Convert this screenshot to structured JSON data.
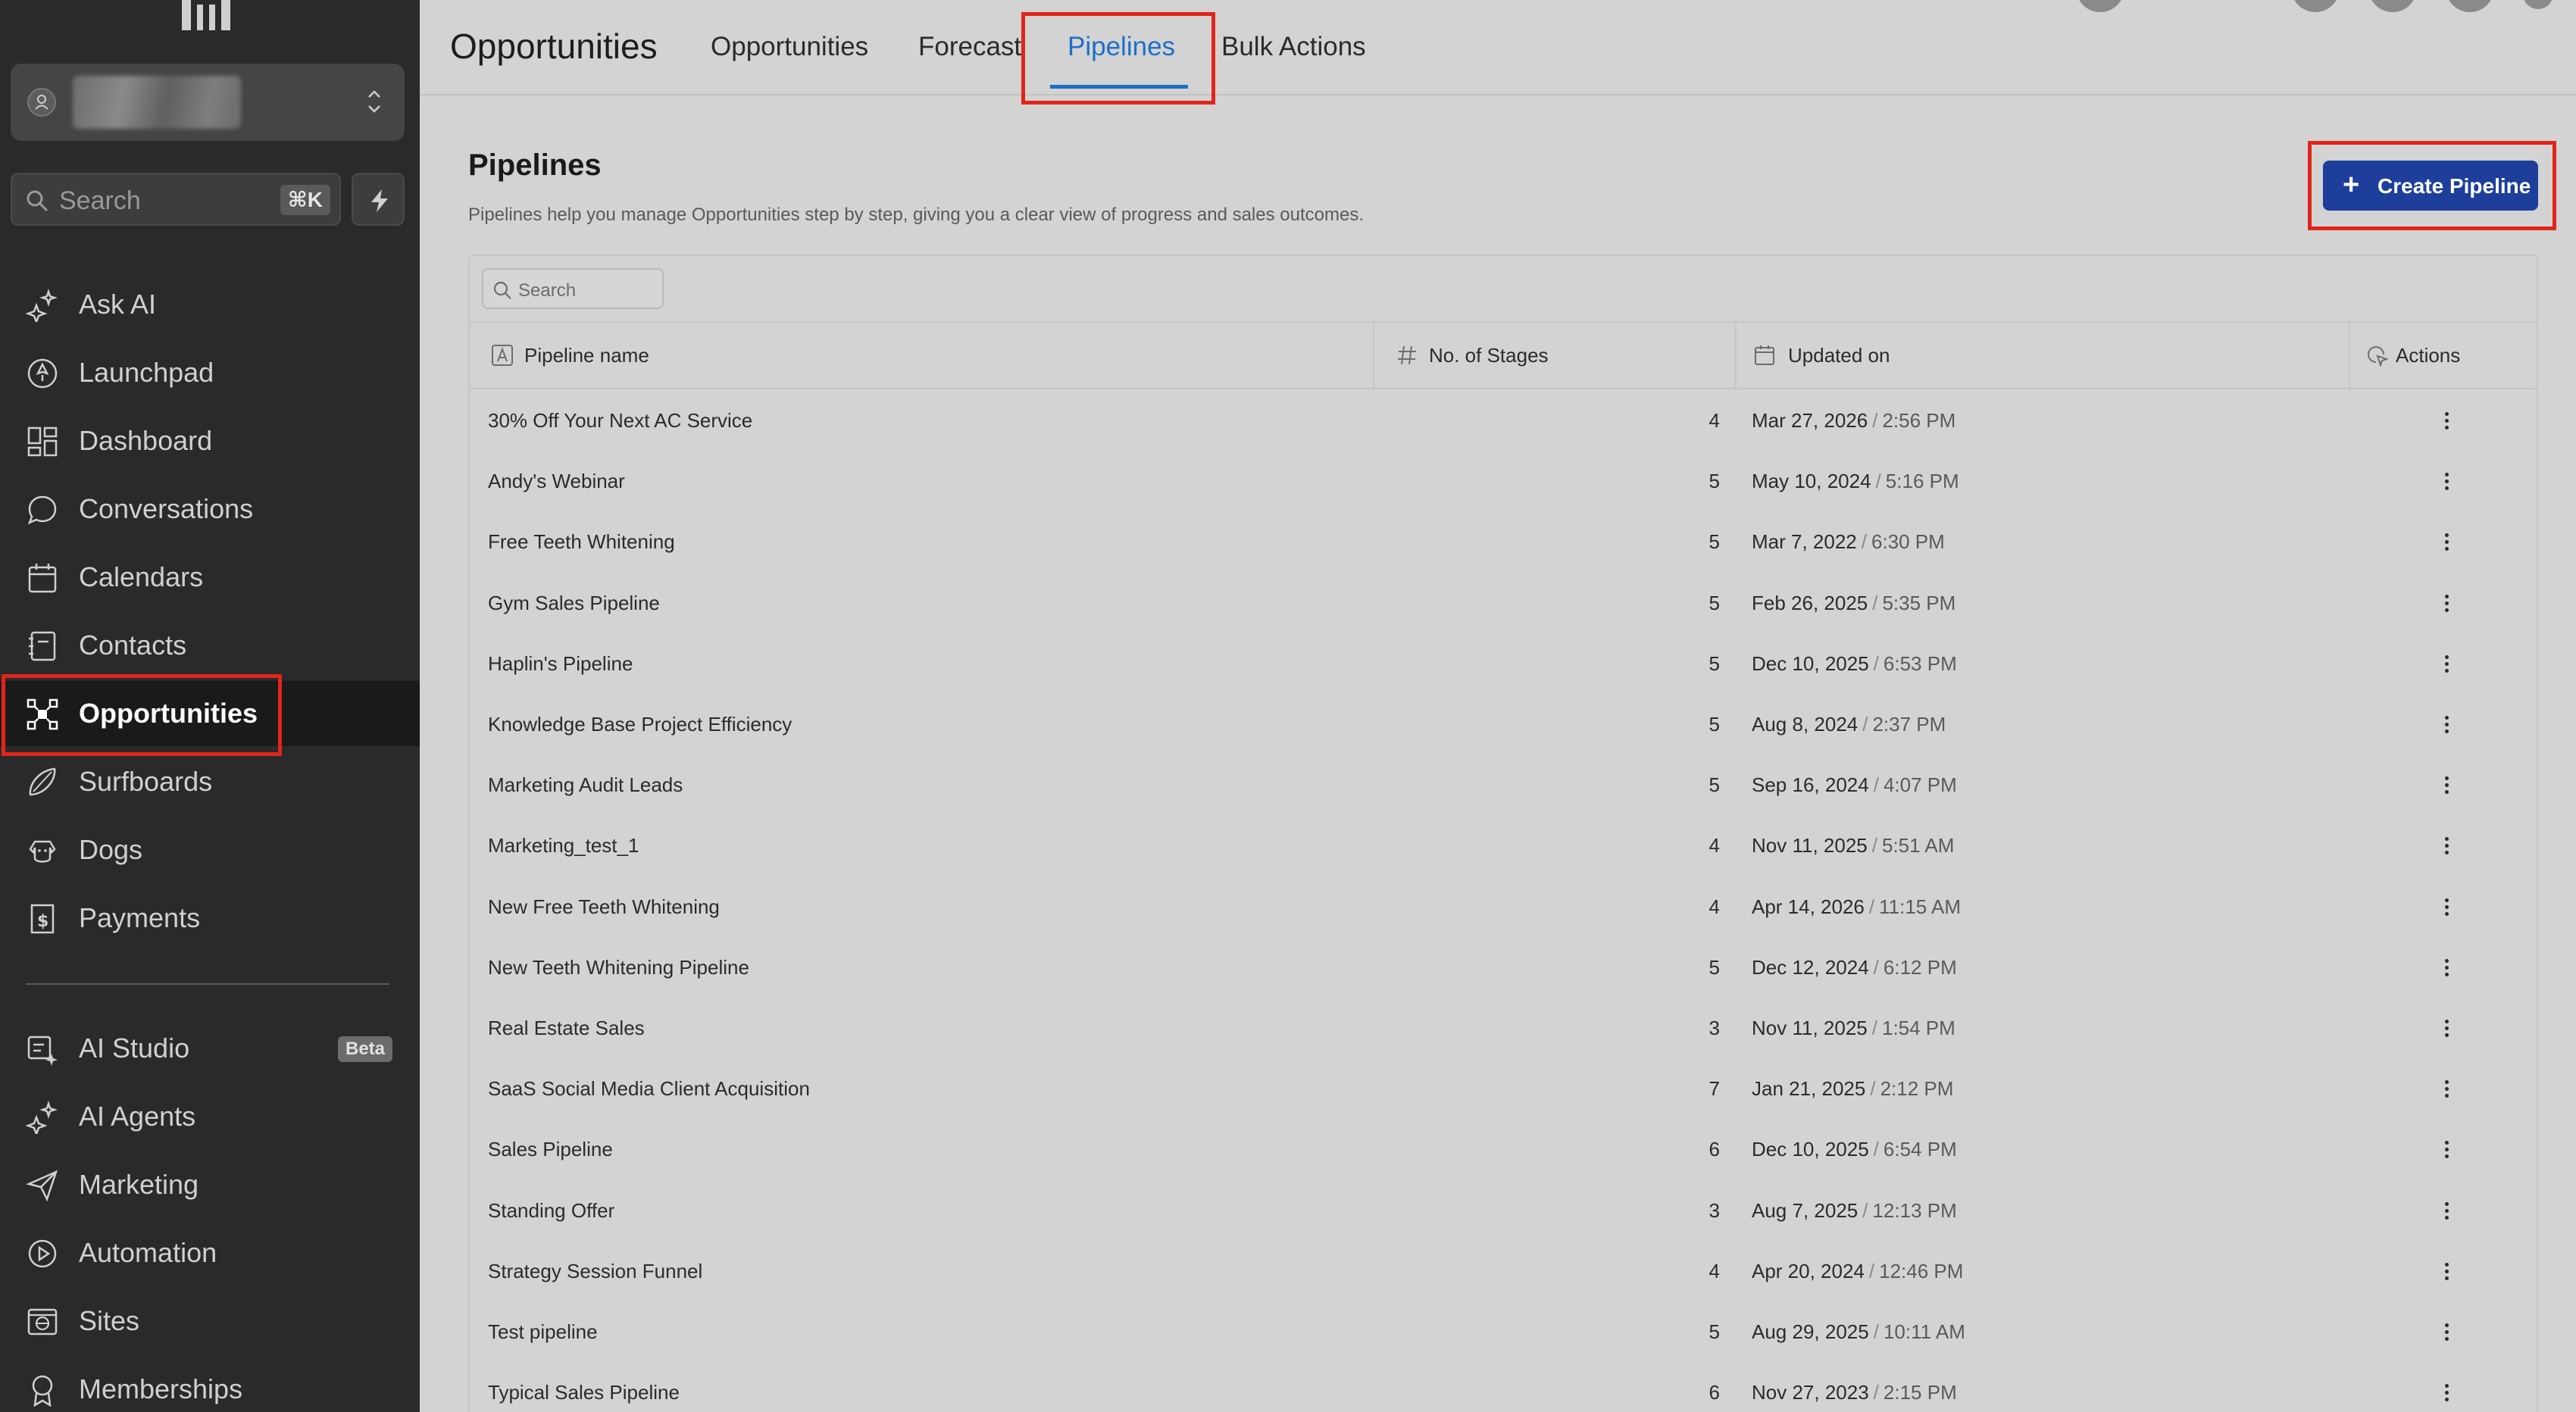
{
  "sidebar": {
    "search_placeholder": "Search",
    "search_shortcut": "⌘K",
    "nav_items": [
      {
        "label": "Ask AI",
        "icon": "sparkle-icon"
      },
      {
        "label": "Launchpad",
        "icon": "rocket-icon"
      },
      {
        "label": "Dashboard",
        "icon": "dashboard-grid-icon"
      },
      {
        "label": "Conversations",
        "icon": "chat-bubble-icon"
      },
      {
        "label": "Calendars",
        "icon": "calendar-icon"
      },
      {
        "label": "Contacts",
        "icon": "contacts-book-icon"
      },
      {
        "label": "Opportunities",
        "icon": "opportunities-icon",
        "active": true
      },
      {
        "label": "Surfboards",
        "icon": "surfboard-icon"
      },
      {
        "label": "Dogs",
        "icon": "dog-icon"
      },
      {
        "label": "Payments",
        "icon": "payments-receipt-icon"
      }
    ],
    "secondary_items": [
      {
        "label": "AI Studio",
        "icon": "ai-studio-icon",
        "badge": "Beta"
      },
      {
        "label": "AI Agents",
        "icon": "sparkle-icon"
      },
      {
        "label": "Marketing",
        "icon": "paper-plane-icon"
      },
      {
        "label": "Automation",
        "icon": "automation-icon"
      },
      {
        "label": "Sites",
        "icon": "globe-window-icon"
      },
      {
        "label": "Memberships",
        "icon": "membership-badge-icon"
      }
    ]
  },
  "header": {
    "title": "Opportunities",
    "tabs": [
      {
        "label": "Opportunities"
      },
      {
        "label": "Forecast"
      },
      {
        "label": "Pipelines",
        "active": true
      },
      {
        "label": "Bulk Actions"
      }
    ]
  },
  "main": {
    "title": "Pipelines",
    "description": "Pipelines help you manage Opportunities step by step, giving you a clear view of progress and sales outcomes.",
    "create_button": "Create Pipeline",
    "table_search_placeholder": "Search",
    "columns": {
      "name": "Pipeline name",
      "stages": "No. of Stages",
      "updated": "Updated on",
      "actions": "Actions"
    },
    "rows": [
      {
        "name": "30% Off Your Next AC Service",
        "stages": "4",
        "date": "Mar 27, 2026",
        "time": "2:56 PM"
      },
      {
        "name": "Andy's Webinar",
        "stages": "5",
        "date": "May 10, 2024",
        "time": "5:16 PM"
      },
      {
        "name": "Free Teeth Whitening",
        "stages": "5",
        "date": "Mar 7, 2022",
        "time": "6:30 PM"
      },
      {
        "name": "Gym Sales Pipeline",
        "stages": "5",
        "date": "Feb 26, 2025",
        "time": "5:35 PM"
      },
      {
        "name": "Haplin's Pipeline",
        "stages": "5",
        "date": "Dec 10, 2025",
        "time": "6:53 PM"
      },
      {
        "name": "Knowledge Base Project Efficiency",
        "stages": "5",
        "date": "Aug 8, 2024",
        "time": "2:37 PM"
      },
      {
        "name": "Marketing Audit Leads",
        "stages": "5",
        "date": "Sep 16, 2024",
        "time": "4:07 PM"
      },
      {
        "name": "Marketing_test_1",
        "stages": "4",
        "date": "Nov 11, 2025",
        "time": "5:51 AM"
      },
      {
        "name": "New Free Teeth Whitening",
        "stages": "4",
        "date": "Apr 14, 2026",
        "time": "11:15 AM"
      },
      {
        "name": "New Teeth Whitening Pipeline",
        "stages": "5",
        "date": "Dec 12, 2024",
        "time": "6:12 PM"
      },
      {
        "name": "Real Estate Sales",
        "stages": "3",
        "date": "Nov 11, 2025",
        "time": "1:54 PM"
      },
      {
        "name": "SaaS Social Media Client Acquisition",
        "stages": "7",
        "date": "Jan 21, 2025",
        "time": "2:12 PM"
      },
      {
        "name": "Sales Pipeline",
        "stages": "6",
        "date": "Dec 10, 2025",
        "time": "6:54 PM"
      },
      {
        "name": "Standing Offer",
        "stages": "3",
        "date": "Aug 7, 2025",
        "time": "12:13 PM"
      },
      {
        "name": "Strategy Session Funnel",
        "stages": "4",
        "date": "Apr 20, 2024",
        "time": "12:46 PM"
      },
      {
        "name": "Test pipeline",
        "stages": "5",
        "date": "Aug 29, 2025",
        "time": "10:11 AM"
      },
      {
        "name": "Typical Sales Pipeline",
        "stages": "6",
        "date": "Nov 27, 2023",
        "time": "2:15 PM"
      }
    ]
  },
  "colors": {
    "sidebar_bg": "#2a2a2a",
    "active_tab": "#1d6fc9",
    "primary_button": "#1d3e9a",
    "highlight_outline": "#e1251b"
  }
}
